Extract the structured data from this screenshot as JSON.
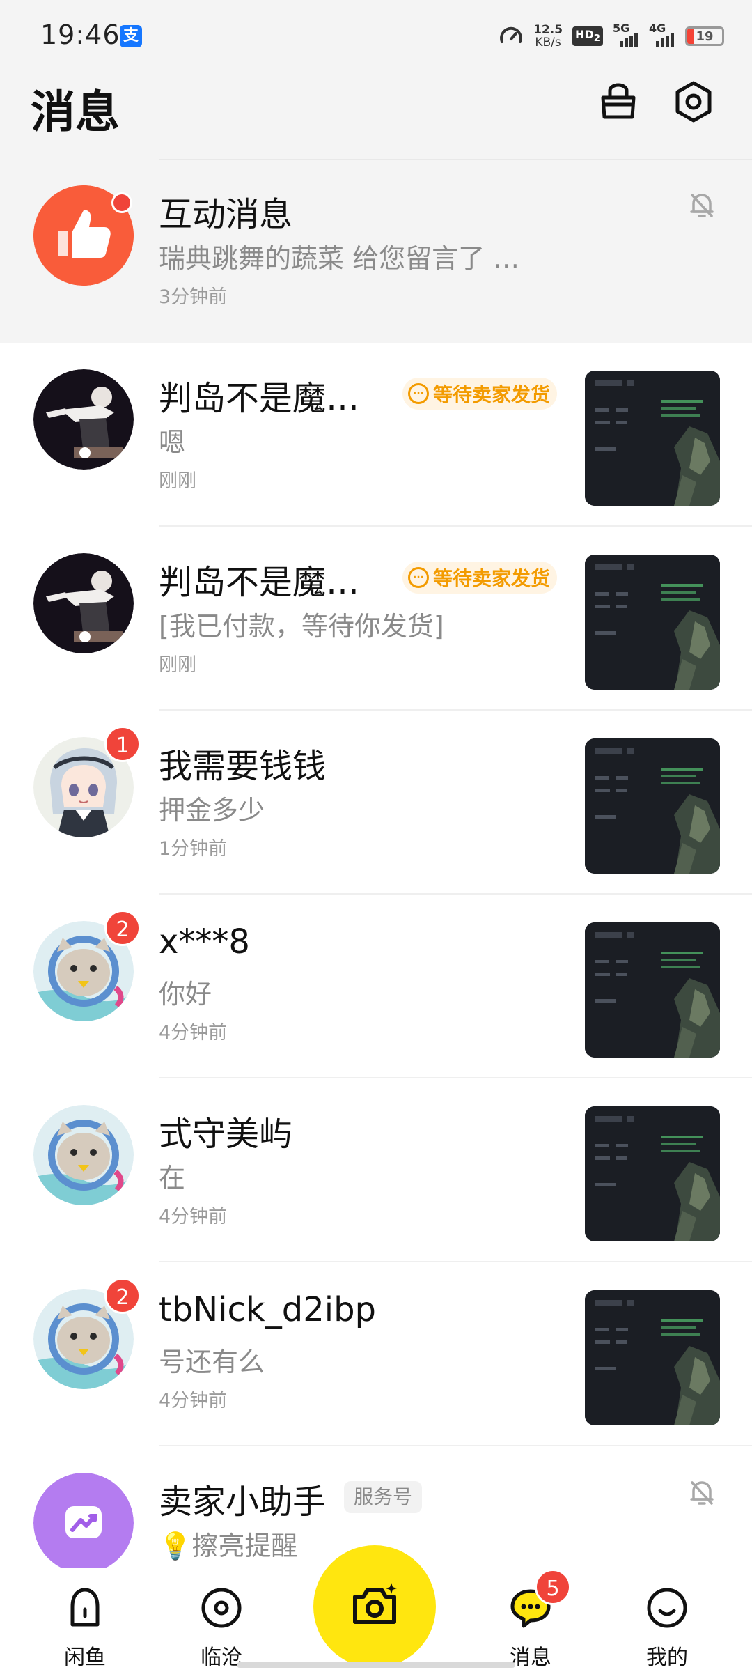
{
  "status_bar": {
    "time": "19:46",
    "alipay_glyph": "支",
    "speed_value": "12.5",
    "speed_unit": "KB/s",
    "hd_label": "HD",
    "hd_sub": "2",
    "net1": "5G",
    "net2": "4G",
    "battery": "19",
    "battery_level_percent": 19
  },
  "header": {
    "title": "消息",
    "icons": [
      "shop-bag-icon",
      "settings-icon"
    ]
  },
  "interact": {
    "name": "互动消息",
    "preview": "瑞典跳舞的蔬菜 给您留言了 …",
    "time": "3分钟前",
    "icon": "thumbs-up-icon",
    "mute_icon": "bell-muted-icon"
  },
  "conversations": [
    {
      "name": "判岛不是魔…",
      "status": "等待卖家发货",
      "preview": "嗯",
      "time": "刚刚",
      "badge": null
    },
    {
      "name": "判岛不是魔…",
      "status": "等待卖家发货",
      "preview": "[我已付款，等待你发货]",
      "time": "刚刚",
      "badge": null
    },
    {
      "name": "我需要钱钱",
      "status": null,
      "preview": "押金多少",
      "time": "1分钟前",
      "badge": "1"
    },
    {
      "name": "x***8",
      "status": null,
      "preview": "你好",
      "time": "4分钟前",
      "badge": "2"
    },
    {
      "name": "式守美屿",
      "status": null,
      "preview": "在",
      "time": "4分钟前",
      "badge": null
    },
    {
      "name": "tbNick_d2ibp",
      "status": null,
      "preview": "号还有么",
      "time": "4分钟前",
      "badge": "2"
    }
  ],
  "assistant": {
    "name": "卖家小助手",
    "tag": "服务号",
    "preview": "擦亮提醒",
    "preview_icon": "lightbulb-icon",
    "mute_icon": "bell-muted-icon"
  },
  "nav": {
    "items": [
      {
        "label": "闲鱼",
        "icon": "home-icon"
      },
      {
        "label": "临沧",
        "icon": "location-icon"
      },
      {
        "label": "消息",
        "icon": "message-icon",
        "badge": "5"
      },
      {
        "label": "我的",
        "icon": "profile-icon"
      }
    ],
    "center_icon": "camera-icon",
    "accent_color": "#ffe60f"
  },
  "colors": {
    "unread_badge": "#f0443a",
    "status_pill_text": "#f39b00",
    "status_pill_bg": "#fff4e3",
    "secondary_text": "#8a8a8a"
  }
}
